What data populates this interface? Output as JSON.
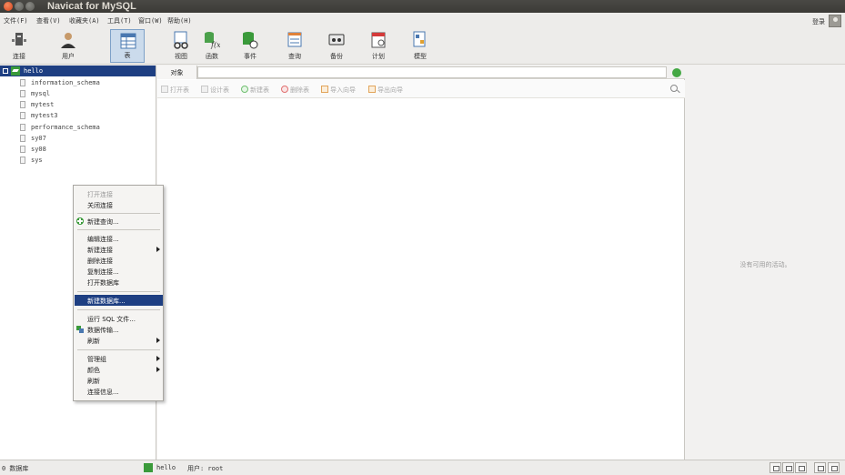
{
  "window": {
    "title": "Navicat for MySQL"
  },
  "menubar": {
    "items": [
      "文件(F)",
      "查看(V)",
      "收藏夹(A)",
      "工具(T)",
      "窗口(W)",
      "帮助(H)"
    ],
    "login_label": "登录"
  },
  "toolbar": {
    "items": [
      {
        "label": "连接",
        "icon": "connection-icon"
      },
      {
        "label": "用户",
        "icon": "user-icon"
      },
      {
        "label": "表",
        "icon": "table-icon",
        "active": true
      },
      {
        "label": "视图",
        "icon": "view-icon"
      },
      {
        "label": "函数",
        "icon": "function-icon"
      },
      {
        "label": "事件",
        "icon": "event-icon"
      },
      {
        "label": "查询",
        "icon": "query-icon"
      },
      {
        "label": "备份",
        "icon": "backup-icon"
      },
      {
        "label": "计划",
        "icon": "schedule-icon"
      },
      {
        "label": "模型",
        "icon": "model-icon"
      }
    ]
  },
  "sidebar": {
    "connection": "hello",
    "databases": [
      "information_schema",
      "mysql",
      "mytest",
      "mytest3",
      "performance_schema",
      "sy07",
      "sy08",
      "sys"
    ]
  },
  "objects": {
    "tab_label": "对象",
    "tools": [
      "打开表",
      "设计表",
      "新建表",
      "删除表",
      "导入向导",
      "导出向导"
    ]
  },
  "right_panel": {
    "empty_text": "没有可用的活动。"
  },
  "context_menu": {
    "items": [
      {
        "label": "打开连接",
        "disabled": true
      },
      {
        "label": "关闭连接"
      },
      {
        "separator": true
      },
      {
        "label": "新建查询...",
        "icon": "new-query-icon"
      },
      {
        "separator": true
      },
      {
        "label": "编辑连接..."
      },
      {
        "label": "新建连接",
        "submenu": true
      },
      {
        "label": "删除连接"
      },
      {
        "label": "复制连接..."
      },
      {
        "label": "打开数据库"
      },
      {
        "separator": true
      },
      {
        "label": "新建数据库...",
        "highlighted": true
      },
      {
        "separator": true
      },
      {
        "label": "运行 SQL 文件..."
      },
      {
        "label": "数据传输...",
        "icon": "data-transfer-icon"
      },
      {
        "label": "刷新",
        "submenu": true
      },
      {
        "separator": true
      },
      {
        "label": "管理组",
        "submenu": true
      },
      {
        "label": "颜色",
        "submenu": true
      },
      {
        "label": "刷新"
      },
      {
        "label": "连接信息..."
      }
    ]
  },
  "statusbar": {
    "left_text": "0 数据库",
    "connection_text": "hello",
    "user_text": "用户: root"
  },
  "colors": {
    "selection": "#1e3f82",
    "active_tool": "#cbdbec",
    "connection_green": "#3a9a3a"
  }
}
